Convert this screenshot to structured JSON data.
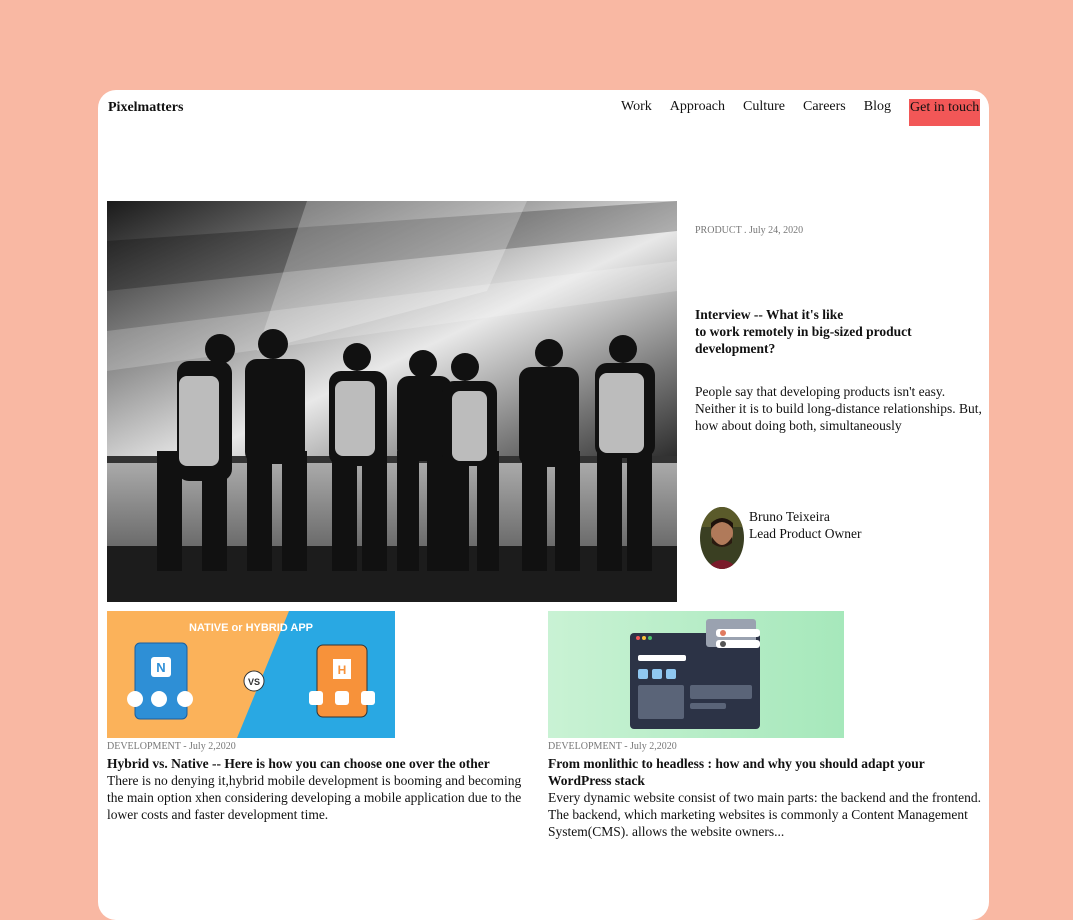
{
  "brand": "Pixelmatters",
  "nav": {
    "items": [
      "Work",
      "Approach",
      "Culture",
      "Careers",
      "Blog"
    ],
    "cta": "Get in touch"
  },
  "colors": {
    "background": "#f9b8a3",
    "cta": "#f25757",
    "card": "#ffffff"
  },
  "featured": {
    "meta": "PRODUCT . July 24, 2020",
    "title_line1": "Interview -- What it's like",
    "title_line2": "to work remotely in big-sized product development?",
    "excerpt": "People say that developing products isn't easy. Neither it is to build long-distance relationships. But, how about doing both, simultaneously",
    "author": {
      "name": "Bruno Teixeira",
      "role": "Lead Product Owner"
    }
  },
  "posts": [
    {
      "meta": "DEVELOPMENT - July 2,2020",
      "title": "Hybrid vs. Native -- Here is how you can choose one over the other",
      "excerpt": "There is no denying it,hybrid mobile development is booming and becoming the main option xhen considering developing a mobile application due to the lower costs and faster development time.",
      "thumb_text": "NATIVE or HYBRID APP"
    },
    {
      "meta": "DEVELOPMENT - July 2,2020",
      "title": "From monlithic to headless : how and why you should adapt your WordPress stack",
      "excerpt": "Every dynamic website consist of two main parts: the backend and the frontend. The backend, which marketing websites is commonly a Content Management System(CMS). allows the website owners..."
    }
  ]
}
